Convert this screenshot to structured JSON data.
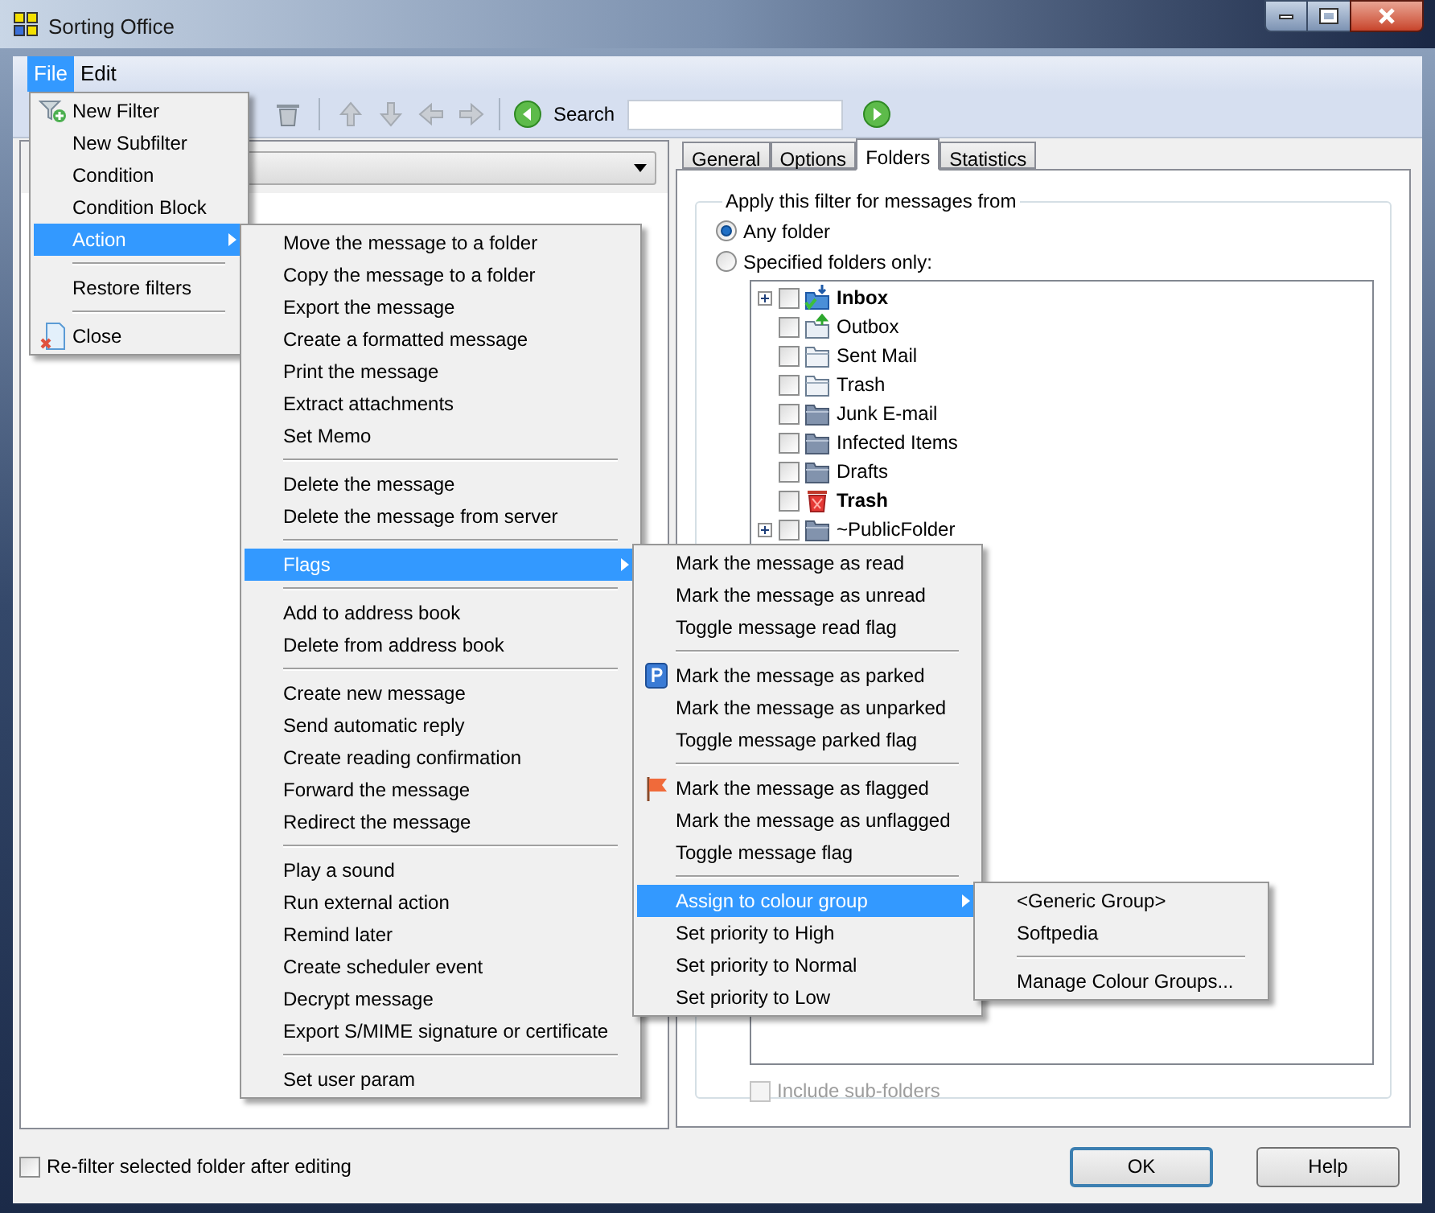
{
  "window": {
    "title": "Sorting Office"
  },
  "menubar": [
    {
      "label": "File",
      "selected": true
    },
    {
      "label": "Edit",
      "selected": false
    }
  ],
  "toolbar": {
    "search_label": "Search"
  },
  "file_menu": [
    {
      "kind": "filter_item",
      "label": "New Filter",
      "selected": false,
      "submenu": false
    },
    {
      "kind": "item",
      "label": "New Subfilter",
      "selected": false,
      "submenu": false
    },
    {
      "kind": "item",
      "label": "Condition",
      "selected": false,
      "submenu": false
    },
    {
      "kind": "item",
      "label": "Condition Block",
      "selected": false,
      "submenu": false
    },
    {
      "kind": "item",
      "label": "Action",
      "selected": true,
      "submenu": true
    },
    {
      "kind": "separator"
    },
    {
      "kind": "item",
      "label": "Restore filters",
      "selected": false,
      "submenu": false
    },
    {
      "kind": "separator"
    },
    {
      "kind": "close_item",
      "label": "Close",
      "selected": false,
      "submenu": false
    }
  ],
  "action_menu": [
    {
      "kind": "item",
      "label": "Move the message to a folder",
      "selected": false,
      "submenu": false
    },
    {
      "kind": "item",
      "label": "Copy the message to a folder",
      "selected": false,
      "submenu": false
    },
    {
      "kind": "item",
      "label": "Export the message",
      "selected": false,
      "submenu": false
    },
    {
      "kind": "item",
      "label": "Create a formatted message",
      "selected": false,
      "submenu": false
    },
    {
      "kind": "item",
      "label": "Print the message",
      "selected": false,
      "submenu": false
    },
    {
      "kind": "item",
      "label": "Extract attachments",
      "selected": false,
      "submenu": false
    },
    {
      "kind": "item",
      "label": "Set Memo",
      "selected": false,
      "submenu": false
    },
    {
      "kind": "separator"
    },
    {
      "kind": "item",
      "label": "Delete the message",
      "selected": false,
      "submenu": false
    },
    {
      "kind": "item",
      "label": "Delete the message from server",
      "selected": false,
      "submenu": false
    },
    {
      "kind": "separator"
    },
    {
      "kind": "item",
      "label": "Flags",
      "selected": true,
      "submenu": true
    },
    {
      "kind": "separator"
    },
    {
      "kind": "item",
      "label": "Add to address book",
      "selected": false,
      "submenu": false
    },
    {
      "kind": "item",
      "label": "Delete from address book",
      "selected": false,
      "submenu": false
    },
    {
      "kind": "separator"
    },
    {
      "kind": "item",
      "label": "Create new message",
      "selected": false,
      "submenu": false
    },
    {
      "kind": "item",
      "label": "Send automatic reply",
      "selected": false,
      "submenu": false
    },
    {
      "kind": "item",
      "label": "Create reading confirmation",
      "selected": false,
      "submenu": false
    },
    {
      "kind": "item",
      "label": "Forward the message",
      "selected": false,
      "submenu": false
    },
    {
      "kind": "item",
      "label": "Redirect the message",
      "selected": false,
      "submenu": false
    },
    {
      "kind": "separator"
    },
    {
      "kind": "item",
      "label": "Play a sound",
      "selected": false,
      "submenu": false
    },
    {
      "kind": "item",
      "label": "Run external action",
      "selected": false,
      "submenu": false
    },
    {
      "kind": "item",
      "label": "Remind later",
      "selected": false,
      "submenu": false
    },
    {
      "kind": "item",
      "label": "Create scheduler event",
      "selected": false,
      "submenu": false
    },
    {
      "kind": "item",
      "label": "Decrypt message",
      "selected": false,
      "submenu": false
    },
    {
      "kind": "item",
      "label": "Export S/MIME signature or certificate",
      "selected": false,
      "submenu": false
    },
    {
      "kind": "separator"
    },
    {
      "kind": "item",
      "label": "Set user param",
      "selected": false,
      "submenu": false
    }
  ],
  "flags_menu": [
    {
      "kind": "item",
      "label": "Mark the message as read",
      "selected": false,
      "submenu": false
    },
    {
      "kind": "item",
      "label": "Mark the message as unread",
      "selected": false,
      "submenu": false
    },
    {
      "kind": "item",
      "label": "Toggle message read flag",
      "selected": false,
      "submenu": false
    },
    {
      "kind": "separator"
    },
    {
      "kind": "parked_item",
      "label": "Mark the message as parked",
      "selected": false,
      "submenu": false
    },
    {
      "kind": "item",
      "label": "Mark the message as unparked",
      "selected": false,
      "submenu": false
    },
    {
      "kind": "item",
      "label": "Toggle message parked flag",
      "selected": false,
      "submenu": false
    },
    {
      "kind": "separator"
    },
    {
      "kind": "flagged_item",
      "label": "Mark the message as flagged",
      "selected": false,
      "submenu": false
    },
    {
      "kind": "item",
      "label": "Mark the message as unflagged",
      "selected": false,
      "submenu": false
    },
    {
      "kind": "item",
      "label": "Toggle message flag",
      "selected": false,
      "submenu": false
    },
    {
      "kind": "separator"
    },
    {
      "kind": "item",
      "label": "Assign to colour group",
      "selected": true,
      "submenu": true
    },
    {
      "kind": "item",
      "label": "Set priority to High",
      "selected": false,
      "submenu": false
    },
    {
      "kind": "item",
      "label": "Set priority to Normal",
      "selected": false,
      "submenu": false
    },
    {
      "kind": "item",
      "label": "Set priority to Low",
      "selected": false,
      "submenu": false
    }
  ],
  "colour_menu": [
    {
      "kind": "item",
      "label": "<Generic Group>",
      "selected": false,
      "submenu": false
    },
    {
      "kind": "item",
      "label": "Softpedia",
      "selected": false,
      "submenu": false
    },
    {
      "kind": "separator"
    },
    {
      "kind": "item",
      "label": "Manage Colour Groups...",
      "selected": false,
      "submenu": false
    }
  ],
  "tabs": [
    {
      "label": "General",
      "selected": false
    },
    {
      "label": "Options",
      "selected": false
    },
    {
      "label": "Folders",
      "selected": true
    },
    {
      "label": "Statistics",
      "selected": false
    }
  ],
  "folders_tab": {
    "group_title": "Apply this filter for messages from",
    "options": [
      {
        "label": "Any folder",
        "selected": true
      },
      {
        "label": "Specified folders only:",
        "selected": false
      }
    ],
    "folders": [
      {
        "name": "Inbox",
        "bold": true,
        "expander": true,
        "checked": false,
        "kind": "inbox"
      },
      {
        "name": "Outbox",
        "bold": false,
        "expander": false,
        "checked": false,
        "kind": "outbox"
      },
      {
        "name": "Sent Mail",
        "bold": false,
        "expander": false,
        "checked": false,
        "kind": "light"
      },
      {
        "name": "Trash",
        "bold": false,
        "expander": false,
        "checked": false,
        "kind": "light"
      },
      {
        "name": "Junk E-mail",
        "bold": false,
        "expander": false,
        "checked": false,
        "kind": "folder"
      },
      {
        "name": "Infected Items",
        "bold": false,
        "expander": false,
        "checked": false,
        "kind": "folder"
      },
      {
        "name": "Drafts",
        "bold": false,
        "expander": false,
        "checked": false,
        "kind": "folder"
      },
      {
        "name": "Trash",
        "bold": true,
        "expander": false,
        "checked": false,
        "kind": "trash"
      },
      {
        "name": "~PublicFolder",
        "bold": false,
        "expander": true,
        "checked": false,
        "kind": "folder"
      }
    ],
    "include_subfolders": {
      "label": "Include sub-folders",
      "checked": false,
      "disabled": true
    }
  },
  "footer": {
    "refilter": {
      "label": "Re-filter selected folder after editing",
      "checked": false
    },
    "buttons": [
      {
        "label": "OK",
        "default": true
      },
      {
        "label": "Help",
        "default": false
      }
    ]
  }
}
